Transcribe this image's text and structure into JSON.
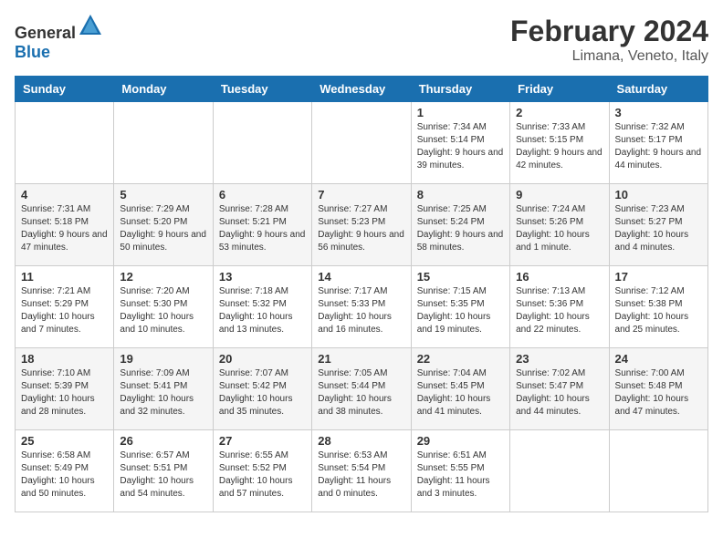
{
  "header": {
    "logo_general": "General",
    "logo_blue": "Blue",
    "month_title": "February 2024",
    "location": "Limana, Veneto, Italy"
  },
  "days_of_week": [
    "Sunday",
    "Monday",
    "Tuesday",
    "Wednesday",
    "Thursday",
    "Friday",
    "Saturday"
  ],
  "weeks": [
    [
      {
        "day": "",
        "info": ""
      },
      {
        "day": "",
        "info": ""
      },
      {
        "day": "",
        "info": ""
      },
      {
        "day": "",
        "info": ""
      },
      {
        "day": "1",
        "info": "Sunrise: 7:34 AM\nSunset: 5:14 PM\nDaylight: 9 hours and 39 minutes."
      },
      {
        "day": "2",
        "info": "Sunrise: 7:33 AM\nSunset: 5:15 PM\nDaylight: 9 hours and 42 minutes."
      },
      {
        "day": "3",
        "info": "Sunrise: 7:32 AM\nSunset: 5:17 PM\nDaylight: 9 hours and 44 minutes."
      }
    ],
    [
      {
        "day": "4",
        "info": "Sunrise: 7:31 AM\nSunset: 5:18 PM\nDaylight: 9 hours and 47 minutes."
      },
      {
        "day": "5",
        "info": "Sunrise: 7:29 AM\nSunset: 5:20 PM\nDaylight: 9 hours and 50 minutes."
      },
      {
        "day": "6",
        "info": "Sunrise: 7:28 AM\nSunset: 5:21 PM\nDaylight: 9 hours and 53 minutes."
      },
      {
        "day": "7",
        "info": "Sunrise: 7:27 AM\nSunset: 5:23 PM\nDaylight: 9 hours and 56 minutes."
      },
      {
        "day": "8",
        "info": "Sunrise: 7:25 AM\nSunset: 5:24 PM\nDaylight: 9 hours and 58 minutes."
      },
      {
        "day": "9",
        "info": "Sunrise: 7:24 AM\nSunset: 5:26 PM\nDaylight: 10 hours and 1 minute."
      },
      {
        "day": "10",
        "info": "Sunrise: 7:23 AM\nSunset: 5:27 PM\nDaylight: 10 hours and 4 minutes."
      }
    ],
    [
      {
        "day": "11",
        "info": "Sunrise: 7:21 AM\nSunset: 5:29 PM\nDaylight: 10 hours and 7 minutes."
      },
      {
        "day": "12",
        "info": "Sunrise: 7:20 AM\nSunset: 5:30 PM\nDaylight: 10 hours and 10 minutes."
      },
      {
        "day": "13",
        "info": "Sunrise: 7:18 AM\nSunset: 5:32 PM\nDaylight: 10 hours and 13 minutes."
      },
      {
        "day": "14",
        "info": "Sunrise: 7:17 AM\nSunset: 5:33 PM\nDaylight: 10 hours and 16 minutes."
      },
      {
        "day": "15",
        "info": "Sunrise: 7:15 AM\nSunset: 5:35 PM\nDaylight: 10 hours and 19 minutes."
      },
      {
        "day": "16",
        "info": "Sunrise: 7:13 AM\nSunset: 5:36 PM\nDaylight: 10 hours and 22 minutes."
      },
      {
        "day": "17",
        "info": "Sunrise: 7:12 AM\nSunset: 5:38 PM\nDaylight: 10 hours and 25 minutes."
      }
    ],
    [
      {
        "day": "18",
        "info": "Sunrise: 7:10 AM\nSunset: 5:39 PM\nDaylight: 10 hours and 28 minutes."
      },
      {
        "day": "19",
        "info": "Sunrise: 7:09 AM\nSunset: 5:41 PM\nDaylight: 10 hours and 32 minutes."
      },
      {
        "day": "20",
        "info": "Sunrise: 7:07 AM\nSunset: 5:42 PM\nDaylight: 10 hours and 35 minutes."
      },
      {
        "day": "21",
        "info": "Sunrise: 7:05 AM\nSunset: 5:44 PM\nDaylight: 10 hours and 38 minutes."
      },
      {
        "day": "22",
        "info": "Sunrise: 7:04 AM\nSunset: 5:45 PM\nDaylight: 10 hours and 41 minutes."
      },
      {
        "day": "23",
        "info": "Sunrise: 7:02 AM\nSunset: 5:47 PM\nDaylight: 10 hours and 44 minutes."
      },
      {
        "day": "24",
        "info": "Sunrise: 7:00 AM\nSunset: 5:48 PM\nDaylight: 10 hours and 47 minutes."
      }
    ],
    [
      {
        "day": "25",
        "info": "Sunrise: 6:58 AM\nSunset: 5:49 PM\nDaylight: 10 hours and 50 minutes."
      },
      {
        "day": "26",
        "info": "Sunrise: 6:57 AM\nSunset: 5:51 PM\nDaylight: 10 hours and 54 minutes."
      },
      {
        "day": "27",
        "info": "Sunrise: 6:55 AM\nSunset: 5:52 PM\nDaylight: 10 hours and 57 minutes."
      },
      {
        "day": "28",
        "info": "Sunrise: 6:53 AM\nSunset: 5:54 PM\nDaylight: 11 hours and 0 minutes."
      },
      {
        "day": "29",
        "info": "Sunrise: 6:51 AM\nSunset: 5:55 PM\nDaylight: 11 hours and 3 minutes."
      },
      {
        "day": "",
        "info": ""
      },
      {
        "day": "",
        "info": ""
      }
    ]
  ]
}
